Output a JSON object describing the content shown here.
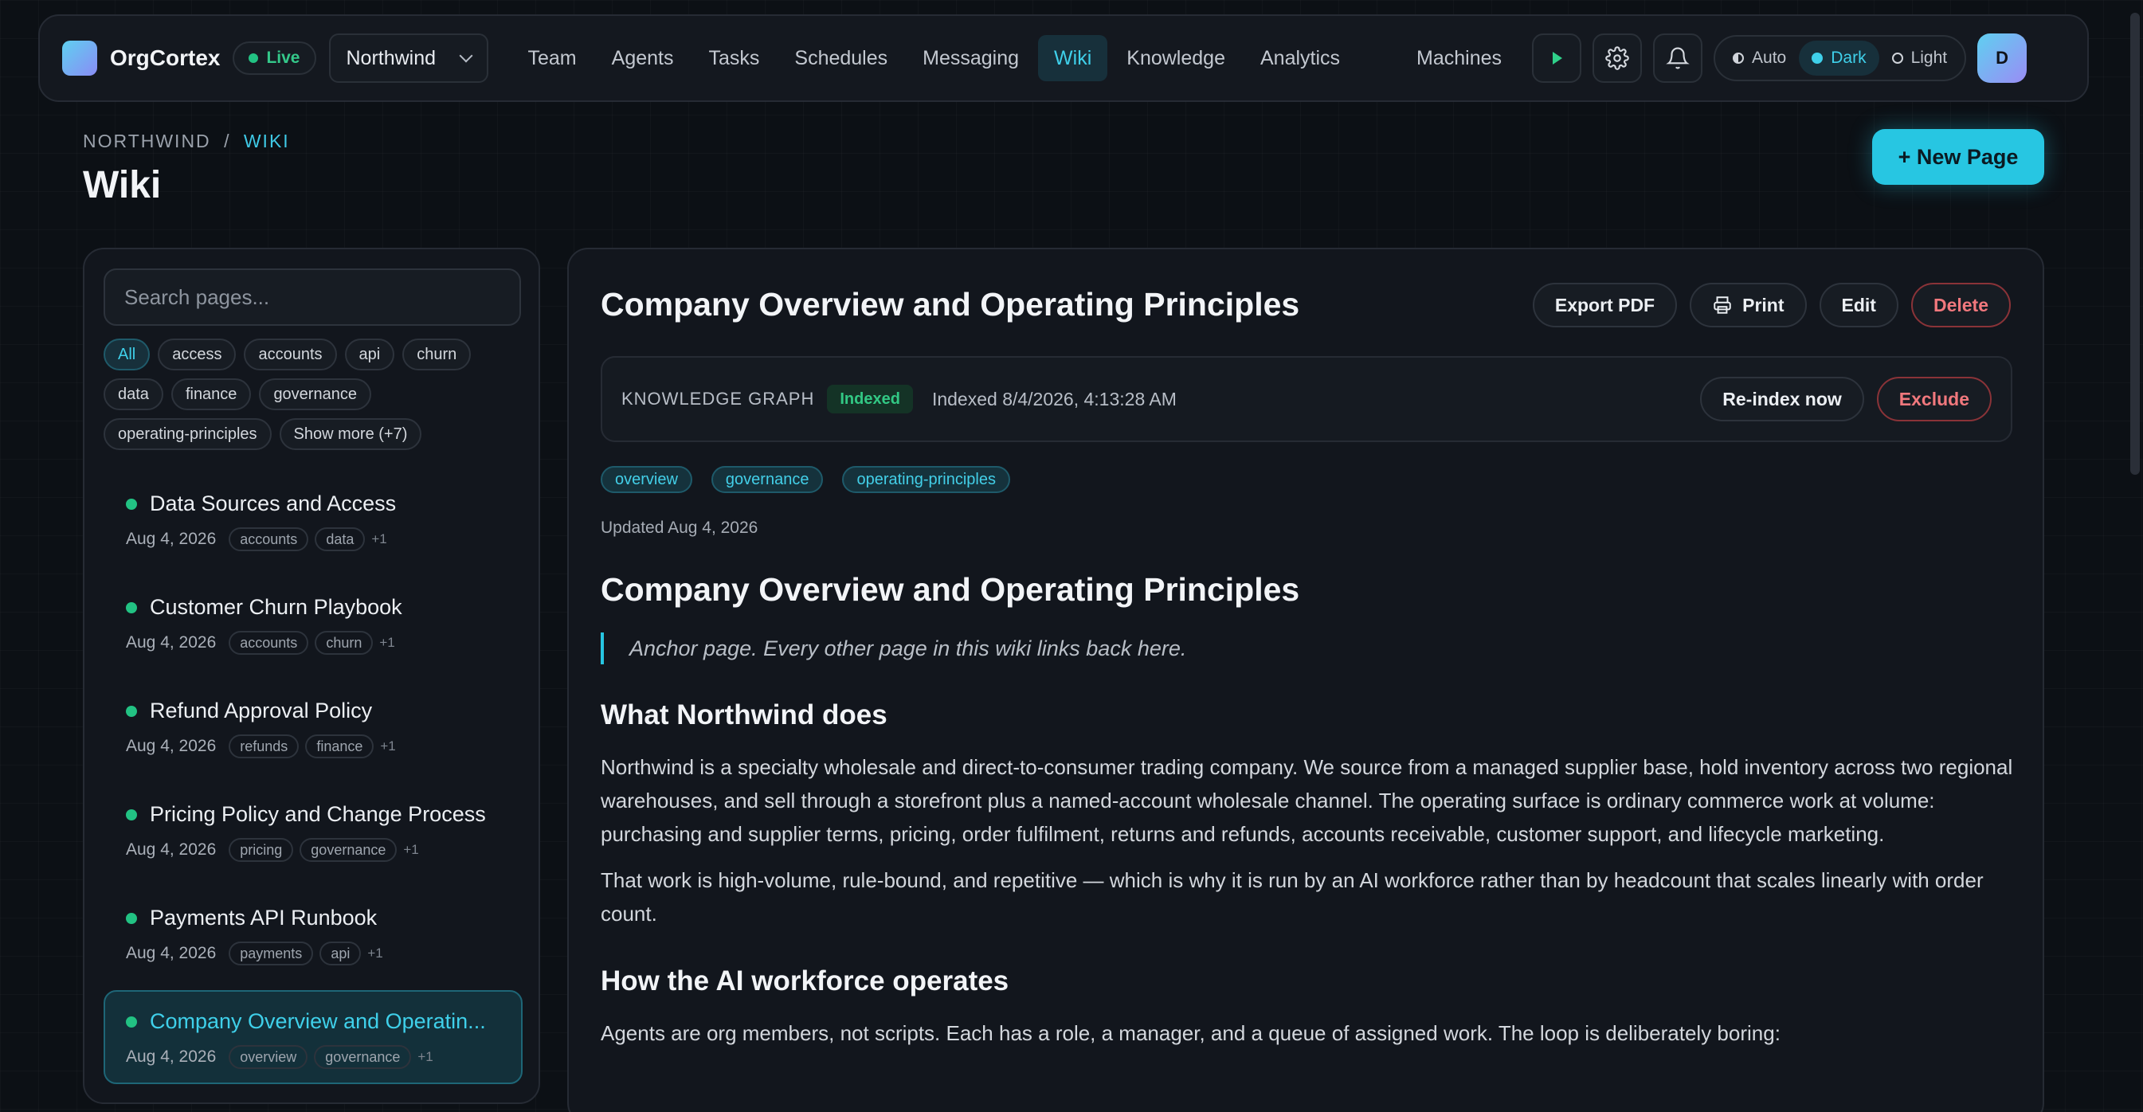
{
  "app": {
    "brand": "OrgCortex",
    "status": "Live",
    "org": "Northwind"
  },
  "nav": {
    "items": [
      "Team",
      "Agents",
      "Tasks",
      "Schedules",
      "Messaging",
      "Wiki",
      "Knowledge",
      "Analytics"
    ],
    "machines": "Machines",
    "active": "Wiki"
  },
  "theme": {
    "options": [
      "Auto",
      "Dark",
      "Light"
    ],
    "selected": "Dark"
  },
  "user": {
    "avatar_initial": "D"
  },
  "header": {
    "breadcrumb_org": "NORTHWIND",
    "breadcrumb_sep": "/",
    "breadcrumb_current": "WIKI",
    "title": "Wiki",
    "new_page": "+ New Page"
  },
  "sidebar": {
    "search_placeholder": "Search pages...",
    "tag_filters": [
      "All",
      "access",
      "accounts",
      "api",
      "churn",
      "data",
      "finance",
      "governance",
      "operating-principles"
    ],
    "show_more": "Show more (+7)",
    "pages": [
      {
        "title": "Data Sources and Access",
        "date": "Aug 4, 2026",
        "tags": [
          "accounts",
          "data"
        ],
        "more": "+1"
      },
      {
        "title": "Customer Churn Playbook",
        "date": "Aug 4, 2026",
        "tags": [
          "accounts",
          "churn"
        ],
        "more": "+1"
      },
      {
        "title": "Refund Approval Policy",
        "date": "Aug 4, 2026",
        "tags": [
          "refunds",
          "finance"
        ],
        "more": "+1"
      },
      {
        "title": "Pricing Policy and Change Process",
        "date": "Aug 4, 2026",
        "tags": [
          "pricing",
          "governance"
        ],
        "more": "+1"
      },
      {
        "title": "Payments API Runbook",
        "date": "Aug 4, 2026",
        "tags": [
          "payments",
          "api"
        ],
        "more": "+1"
      },
      {
        "title": "Company Overview and Operatin...",
        "date": "Aug 4, 2026",
        "tags": [
          "overview",
          "governance"
        ],
        "more": "+1"
      }
    ]
  },
  "doc": {
    "title": "Company Overview and Operating Principles",
    "actions": {
      "export": "Export PDF",
      "print": "Print",
      "edit": "Edit",
      "delete": "Delete"
    },
    "kg": {
      "label": "KNOWLEDGE GRAPH",
      "status": "Indexed",
      "indexed_at": "Indexed 8/4/2026, 4:13:28 AM",
      "reindex": "Re-index now",
      "exclude": "Exclude"
    },
    "tags": [
      "overview",
      "governance",
      "operating-principles"
    ],
    "updated": "Updated Aug 4, 2026",
    "heading": "Company Overview and Operating Principles",
    "quote": "Anchor page. Every other page in this wiki links back here.",
    "section1_title": "What Northwind does",
    "section1_p1": "Northwind is a specialty wholesale and direct-to-consumer trading company. We source from a managed supplier base, hold inventory across two regional warehouses, and sell through a storefront plus a named-account wholesale channel. The operating surface is ordinary commerce work at volume: purchasing and supplier terms, pricing, order fulfilment, returns and refunds, accounts receivable, customer support, and lifecycle marketing.",
    "section1_p2": "That work is high-volume, rule-bound, and repetitive — which is why it is run by an AI workforce rather than by headcount that scales linearly with order count.",
    "section2_title": "How the AI workforce operates",
    "section2_p1": "Agents are org members, not scripts. Each has a role, a manager, and a queue of assigned work. The loop is deliberately boring:"
  },
  "colors": {
    "accent": "#27c6e2",
    "success": "#22c283",
    "danger": "#f1787d"
  }
}
